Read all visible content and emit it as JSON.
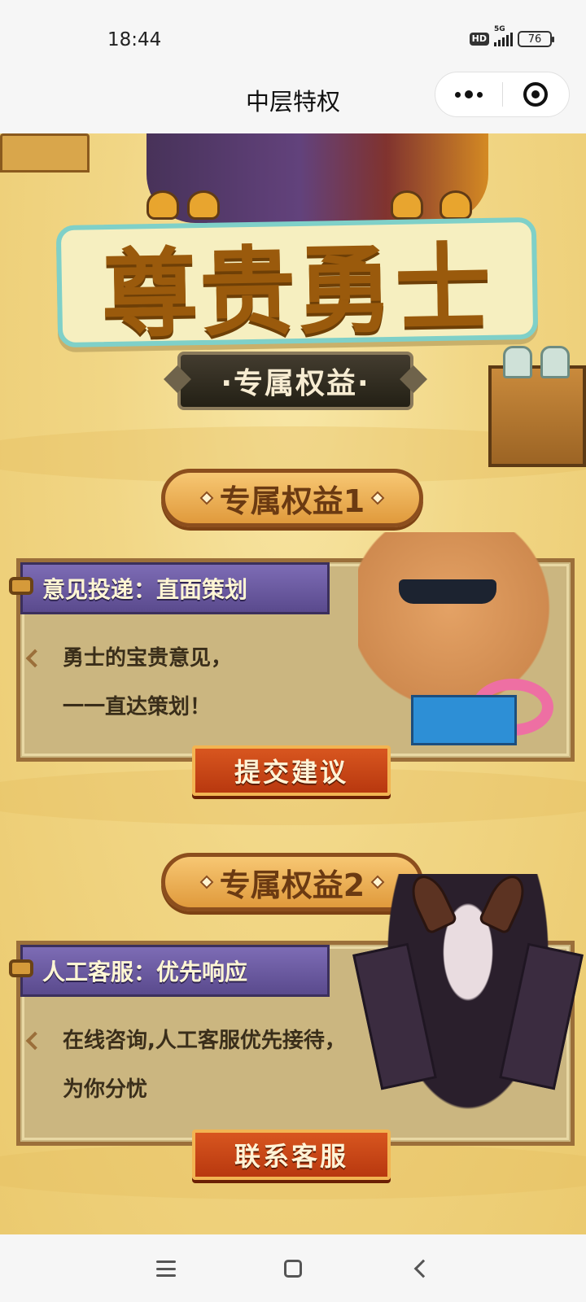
{
  "status_bar": {
    "time": "18:44",
    "hd_label": "HD",
    "network_label": "5G",
    "battery_level": "76"
  },
  "title_bar": {
    "title": "中层特权",
    "more_icon": "more-dots-icon",
    "close_icon": "target-close-icon"
  },
  "hero": {
    "title": "尊贵勇士",
    "subtitle": "·专属权益·"
  },
  "sections": [
    {
      "badge": "专属权益1",
      "header": "意见投递：直面策划",
      "lines": [
        "勇士的宝贵意见，",
        "一一直达策划！"
      ],
      "button": "提交建议"
    },
    {
      "badge": "专属权益2",
      "header": "人工客服：优先响应",
      "lines": [
        "在线咨询,人工客服优先接待，",
        "为你分忧"
      ],
      "button": "联系客服"
    }
  ],
  "nav_bar": {
    "menu_icon": "menu-icon",
    "home_icon": "home-square-icon",
    "back_icon": "back-chevron-icon"
  },
  "colors": {
    "background": "#f1d685",
    "title_text": "#9a5a0c",
    "header_purple": "#6b5ba2",
    "button_red": "#c8451a"
  }
}
